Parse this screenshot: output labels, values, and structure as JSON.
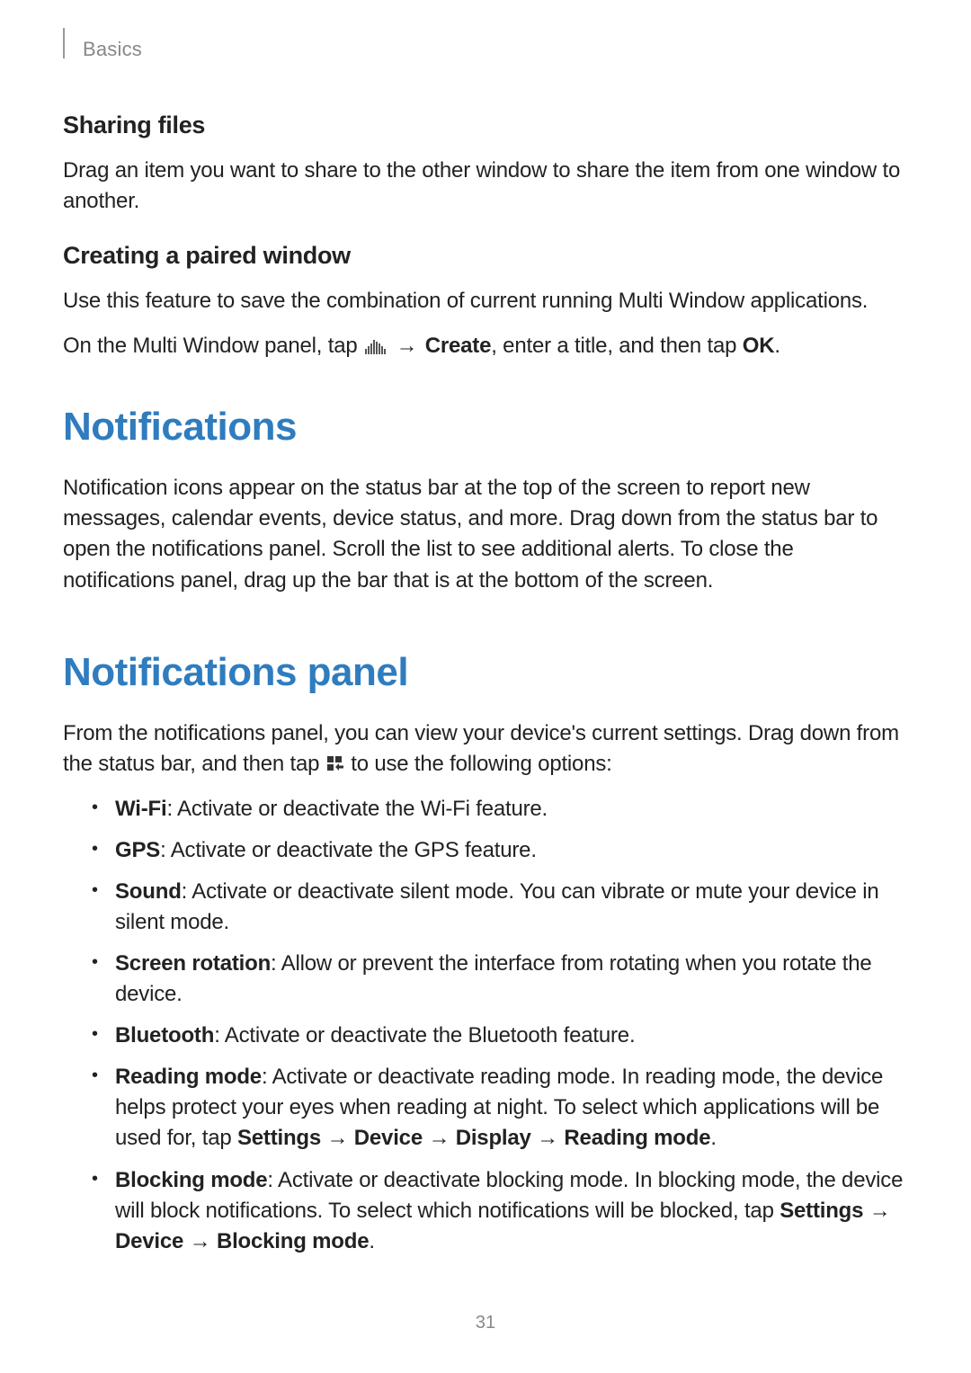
{
  "breadcrumb": "Basics",
  "page_number": "31",
  "section1": {
    "heading": "Sharing files",
    "body": "Drag an item you want to share to the other window to share the item from one window to another."
  },
  "section2": {
    "heading": "Creating a paired window",
    "body1": "Use this feature to save the combination of current running Multi Window applications.",
    "body2_pre": "On the Multi Window panel, tap ",
    "body2_arrow": " → ",
    "body2_bold1": "Create",
    "body2_mid": ", enter a title, and then tap ",
    "body2_bold2": "OK",
    "body2_post": "."
  },
  "section3": {
    "heading": "Notifications",
    "body": "Notification icons appear on the status bar at the top of the screen to report new messages, calendar events, device status, and more. Drag down from the status bar to open the notifications panel. Scroll the list to see additional alerts. To close the notifications panel, drag up the bar that is at the bottom of the screen."
  },
  "section4": {
    "heading": "Notifications panel",
    "intro_pre": "From the notifications panel, you can view your device's current settings. Drag down from the status bar, and then tap ",
    "intro_post": " to use the following options:",
    "items": [
      {
        "term": "Wi-Fi",
        "desc": ": Activate or deactivate the Wi-Fi feature."
      },
      {
        "term": "GPS",
        "desc": ": Activate or deactivate the GPS feature."
      },
      {
        "term": "Sound",
        "desc": ": Activate or deactivate silent mode. You can vibrate or mute your device in silent mode."
      },
      {
        "term": "Screen rotation",
        "desc": ": Allow or prevent the interface from rotating when you rotate the device."
      },
      {
        "term": "Bluetooth",
        "desc": ": Activate or deactivate the Bluetooth feature."
      }
    ],
    "reading": {
      "term": "Reading mode",
      "desc_pre": ": Activate or deactivate reading mode. In reading mode, the device helps protect your eyes when reading at night. To select which applications will be used for, tap ",
      "path": "Settings → Device → Display → Reading mode",
      "desc_post": "."
    },
    "blocking": {
      "term": "Blocking mode",
      "desc_pre": ": Activate or deactivate blocking mode. In blocking mode, the device will block notifications. To select which notifications will be blocked, tap ",
      "path1": "Settings → Device",
      "path_break": " → ",
      "path2": "Blocking mode",
      "desc_post": "."
    }
  }
}
